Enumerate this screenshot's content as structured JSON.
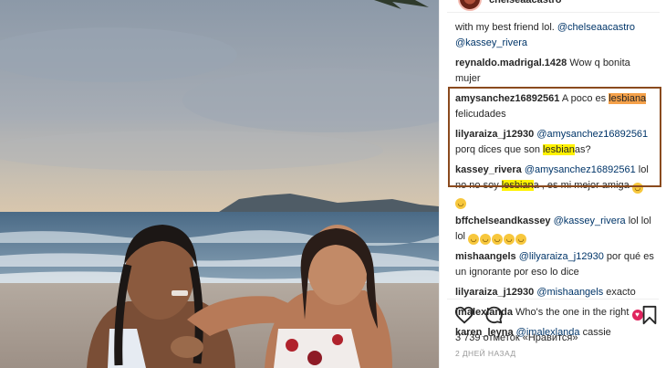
{
  "post": {
    "author": "chelseaacastro",
    "likes_text": "3 739 отметок «Нравится»",
    "time_text": "2 ДНЕЙ НАЗАД"
  },
  "caption": {
    "text": "with my best friend lol.",
    "mention1": "@chelseaacastro",
    "mention2": "@kassey_rivera"
  },
  "comments": [
    {
      "user": "reynaldo.madrigal.1428",
      "text": " Wow q bonita mujer"
    },
    {
      "user": "amysanchez16892561",
      "pre": " A poco es ",
      "hl": "lesbiana",
      "post": " felicudades"
    },
    {
      "user": "lilyaraiza_j12930",
      "mention": "@amysanchez16892561",
      "pre": " porq dices que son ",
      "hl": "lesbian",
      "post": "as?"
    },
    {
      "user": "kassey_rivera",
      "mention": "@amysanchez16892561",
      "pre": " lol no no soy ",
      "hl": "lesbian",
      "post": "a , es mi mejor amiga "
    },
    {
      "user": "bffchelseandkassey",
      "mention": "@kassey_rivera",
      "text": " lol lol lol "
    },
    {
      "user": "mishaangels",
      "mention": "@lilyaraiza_j12930",
      "text": " por qué es un ignorante por eso lo dice"
    },
    {
      "user": "lilyaraiza_j12930",
      "mention": "@mishaangels",
      "text": " exacto"
    },
    {
      "user": "imalexlanda",
      "text": " Who's the one in the right "
    },
    {
      "user": "karen_leyna",
      "mention": "@imalexlanda",
      "text": " cassie"
    }
  ],
  "emojis": {
    "laugh": "laughing-face",
    "heart_eyes": "heart-eyes-face"
  },
  "colors": {
    "highlight": "#fff200",
    "highlight_orange": "#f5a14a",
    "annotation_box": "#8a4a1e",
    "mention": "#003569"
  }
}
